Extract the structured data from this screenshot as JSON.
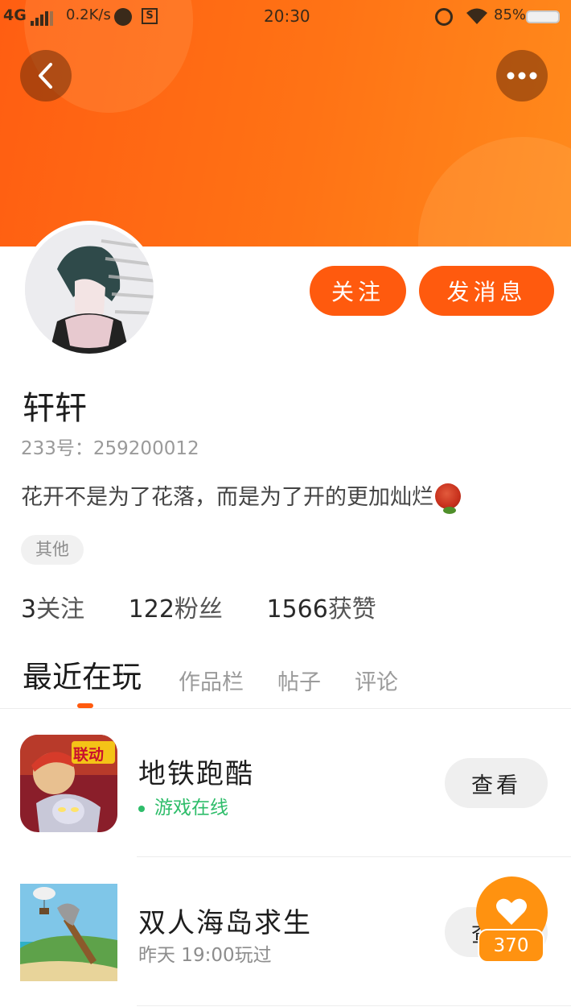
{
  "status_bar": {
    "network": "4G",
    "speed": "0.2K/s",
    "time": "20:30",
    "battery": "85%",
    "icons": [
      "signal-icon",
      "planet-icon",
      "s-icon",
      "alarm-icon",
      "wifi-icon",
      "battery-icon"
    ]
  },
  "header": {
    "back_icon": "back-arrow-icon",
    "more_icon": "more-dots-icon",
    "accent_color": "#ff6a12"
  },
  "profile": {
    "name": "轩轩",
    "uid": "233号：259200012",
    "bio": "花开不是为了花落，而是为了开的更加灿烂",
    "bio_emoji": "rose-icon",
    "tag": "其他",
    "follow_label": "关注",
    "message_label": "发消息"
  },
  "stats": [
    {
      "value": "3",
      "label": "关注"
    },
    {
      "value": "122",
      "label": "粉丝"
    },
    {
      "value": "1566",
      "label": "获赞"
    }
  ],
  "tabs": [
    {
      "label": "最近在玩",
      "active": true
    },
    {
      "label": "作品栏",
      "active": false
    },
    {
      "label": "帖子",
      "active": false
    },
    {
      "label": "评论",
      "active": false
    }
  ],
  "games": [
    {
      "title": "地铁跑酷",
      "status": "游戏在线",
      "button": "查看",
      "icon_badge": "联动"
    },
    {
      "title": "双人海岛求生",
      "status": "昨天 19:00玩过",
      "button": "查看"
    }
  ],
  "like_fab": {
    "count": "370",
    "icon": "heart-icon"
  }
}
